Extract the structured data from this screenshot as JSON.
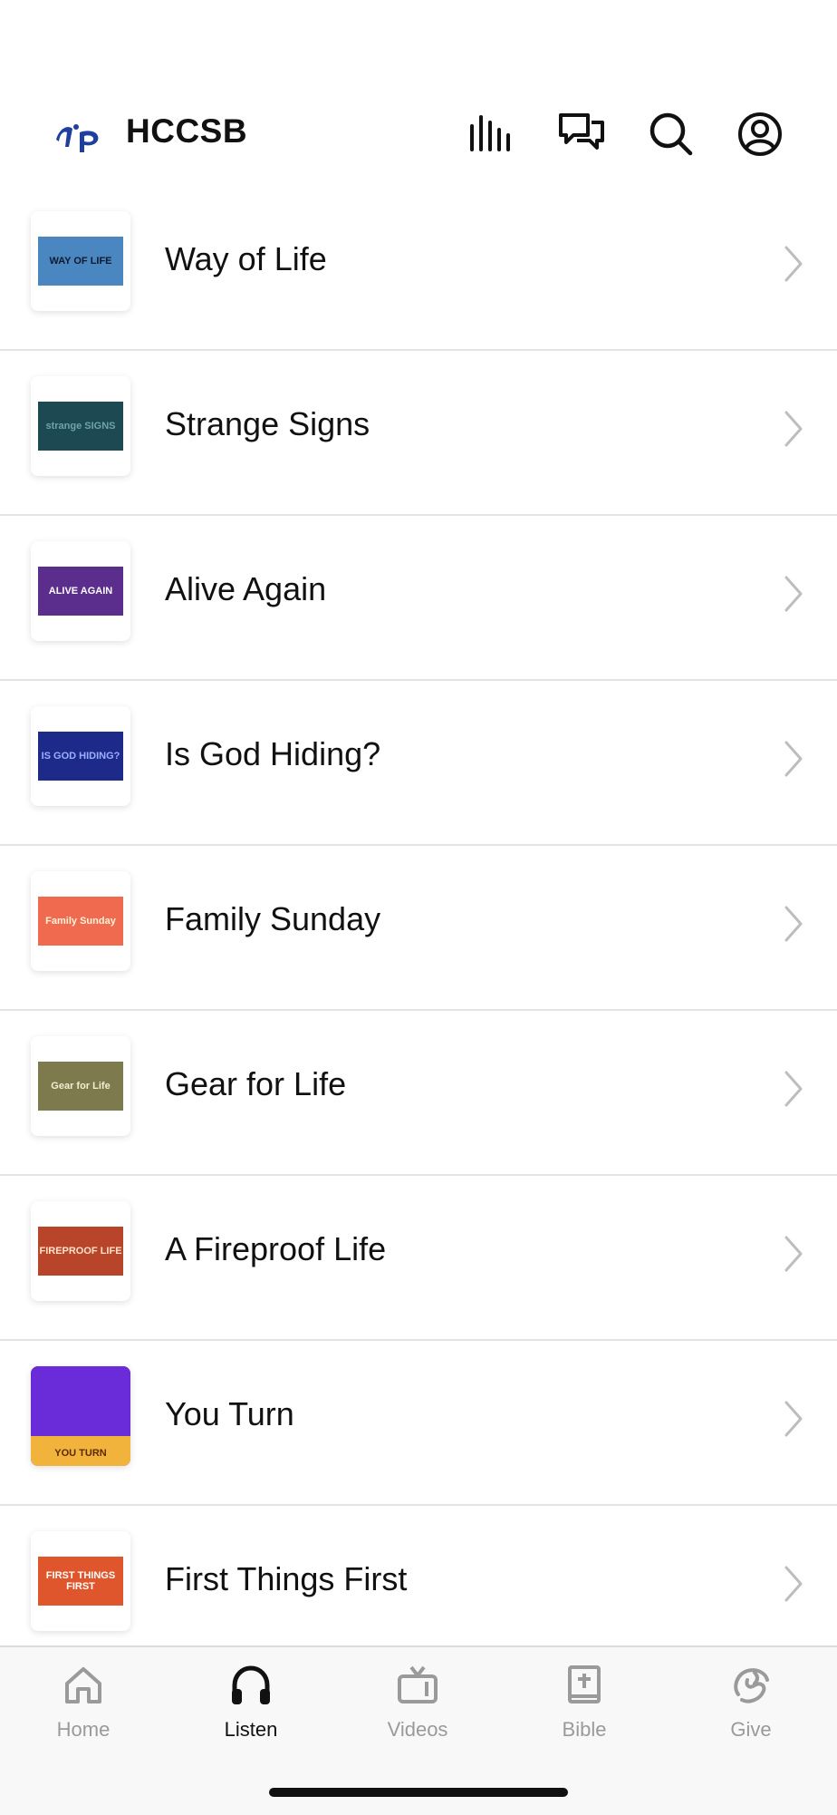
{
  "header": {
    "title": "HCCSB",
    "icons": [
      "audio-bars-icon",
      "chat-icon",
      "search-icon",
      "profile-icon"
    ]
  },
  "list": {
    "items": [
      {
        "title": "Way of Life",
        "thumb_text": "WAY OF LIFE",
        "thumb_bg": "#4a86c0",
        "thumb_fg": "#0e1a30"
      },
      {
        "title": "Strange Signs",
        "thumb_text": "strange SIGNS",
        "thumb_bg": "#1d4a52",
        "thumb_fg": "#6fa3a8"
      },
      {
        "title": "Alive Again",
        "thumb_text": "ALIVE AGAIN",
        "thumb_bg": "#5b2d8c",
        "thumb_fg": "#ffffff"
      },
      {
        "title": "Is God Hiding?",
        "thumb_text": "IS GOD HIDING?",
        "thumb_bg": "#1e2a8a",
        "thumb_fg": "#9ab0ff"
      },
      {
        "title": "Family Sunday",
        "thumb_text": "Family Sunday",
        "thumb_bg": "#ef6a4f",
        "thumb_fg": "#fff3d8"
      },
      {
        "title": "Gear for Life",
        "thumb_text": "Gear for Life",
        "thumb_bg": "#7d7a4e",
        "thumb_fg": "#f2eed0"
      },
      {
        "title": "A Fireproof Life",
        "thumb_text": "FIREPROOF LIFE",
        "thumb_bg": "#b8452a",
        "thumb_fg": "#ffe2c8"
      },
      {
        "title": "You Turn",
        "thumb_text": "YOU TURN",
        "thumb_bg": "#6a2bd8",
        "thumb_fg": "#5a2a00"
      },
      {
        "title": "First Things First",
        "thumb_text": "FIRST THINGS FIRST",
        "thumb_bg": "#e0562c",
        "thumb_fg": "#ffffff"
      }
    ]
  },
  "tabbar": {
    "tabs": [
      {
        "label": "Home",
        "icon": "home-icon"
      },
      {
        "label": "Listen",
        "icon": "headphones-icon",
        "active": true
      },
      {
        "label": "Videos",
        "icon": "tv-icon"
      },
      {
        "label": "Bible",
        "icon": "bible-icon"
      },
      {
        "label": "Give",
        "icon": "give-icon"
      }
    ]
  },
  "colors": {
    "brand": "#1f3fa0",
    "divider": "#e4e4e4",
    "inactive_tab": "#9a9a9a",
    "chevron": "#bdbdbd"
  }
}
